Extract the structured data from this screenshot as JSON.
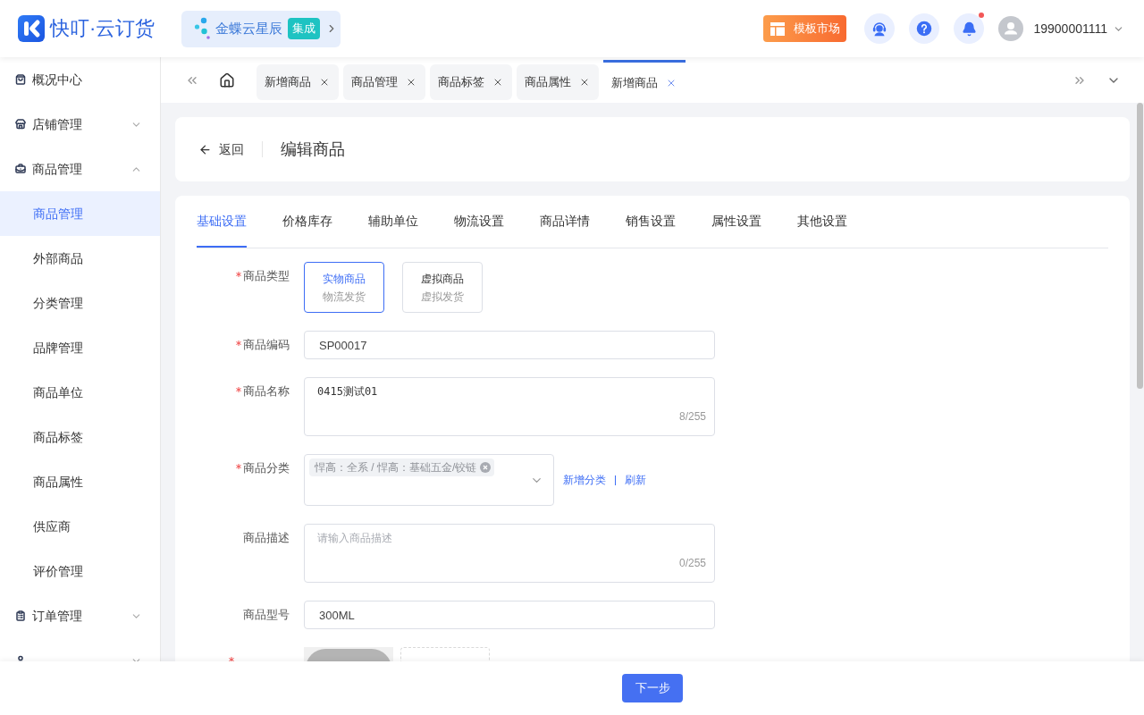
{
  "header": {
    "logo": "快叮·云订货",
    "integration": {
      "name": "金蝶云星辰",
      "badge": "集成"
    },
    "template_market": "模板市场",
    "notifications": {
      "unread": true
    },
    "user": "19900001111"
  },
  "sidebar": {
    "items": [
      {
        "kind": "link",
        "label": "概况中心"
      },
      {
        "kind": "group",
        "label": "店铺管理",
        "expanded": false
      },
      {
        "kind": "group",
        "label": "商品管理",
        "expanded": true,
        "children": [
          {
            "label": "商品管理",
            "selected": true
          },
          {
            "label": "外部商品",
            "selected": false
          },
          {
            "label": "分类管理",
            "selected": false
          },
          {
            "label": "品牌管理",
            "selected": false
          },
          {
            "label": "商品单位",
            "selected": false
          },
          {
            "label": "商品标签",
            "selected": false
          },
          {
            "label": "商品属性",
            "selected": false
          },
          {
            "label": "供应商",
            "selected": false
          },
          {
            "label": "评价管理",
            "selected": false
          }
        ]
      },
      {
        "kind": "group",
        "label": "订单管理",
        "expanded": false
      },
      {
        "kind": "group",
        "expanded": false
      }
    ]
  },
  "page_tabs": [
    {
      "label": "新增商品",
      "selected": false
    },
    {
      "label": "商品管理",
      "selected": false
    },
    {
      "label": "商品标签",
      "selected": false
    },
    {
      "label": "商品属性",
      "selected": false
    },
    {
      "label": "新增商品",
      "selected": true
    }
  ],
  "page_header": {
    "back": "返回",
    "title": "编辑商品"
  },
  "form_tabs": [
    {
      "label": "基础设置",
      "selected": true
    },
    {
      "label": "价格库存",
      "selected": false
    },
    {
      "label": "辅助单位",
      "selected": false
    },
    {
      "label": "物流设置",
      "selected": false
    },
    {
      "label": "商品详情",
      "selected": false
    },
    {
      "label": "销售设置",
      "selected": false
    },
    {
      "label": "属性设置",
      "selected": false
    },
    {
      "label": "其他设置",
      "selected": false
    }
  ],
  "form": {
    "fields": [
      {
        "kind": "choice",
        "label": "商品类型",
        "required": true,
        "options": [
          {
            "title": "实物商品",
            "subtitle": "物流发货",
            "selected": true
          },
          {
            "title": "虚拟商品",
            "subtitle": "虚拟发货",
            "selected": false
          }
        ]
      },
      {
        "kind": "input",
        "label": "商品编码",
        "required": true,
        "value": "SP00017"
      },
      {
        "kind": "textarea",
        "label": "商品名称",
        "required": true,
        "value": "0415测试01",
        "counter": "8/255"
      },
      {
        "kind": "select",
        "label": "商品分类",
        "required": true,
        "tags": [
          "悍高：全系 / 悍高：基础五金/铰链"
        ],
        "links": [
          "新增分类",
          "刷新"
        ]
      },
      {
        "kind": "textarea",
        "label": "商品描述",
        "required": false,
        "placeholder": "请输入商品描述",
        "counter": "0/255"
      },
      {
        "kind": "input",
        "label": "商品型号",
        "required": false,
        "value": "300ML"
      },
      {
        "kind": "upload",
        "required": true
      }
    ]
  },
  "footer": {
    "next": "下一步"
  }
}
